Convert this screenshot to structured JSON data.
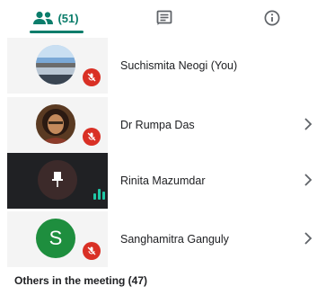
{
  "tabs": {
    "people_count": "(51)",
    "people_icon": "people-icon",
    "chat_icon": "chat-icon",
    "info_icon": "info-icon"
  },
  "colors": {
    "accent": "#0b7d6b",
    "muted_badge": "#d93025",
    "active_tile": "#202124",
    "speaking": "#1fc7a6"
  },
  "participants": [
    {
      "name": "Suchismita Neogi (You)",
      "muted": true,
      "avatar": "landscape-photo"
    },
    {
      "name": "Dr Rumpa Das",
      "muted": true,
      "avatar": "portrait-photo"
    },
    {
      "name": "Rinita Mazumdar",
      "muted": false,
      "speaking": true,
      "pinned_icon": "pin-icon"
    },
    {
      "name": "Sanghamitra Ganguly",
      "muted": true,
      "avatar_letter": "S"
    }
  ],
  "others_label": "Others in the meeting (47)"
}
